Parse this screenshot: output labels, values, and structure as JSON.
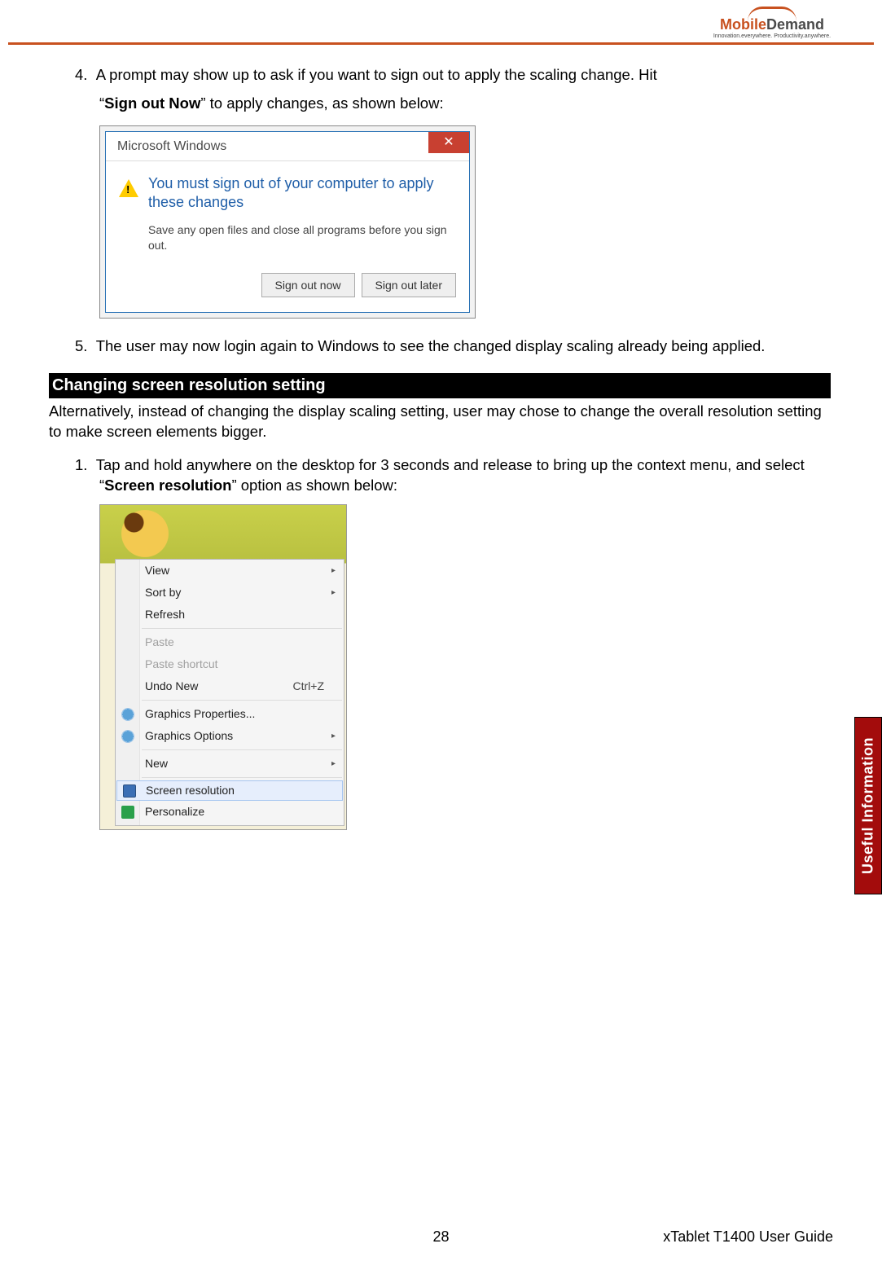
{
  "logo": {
    "brand_part1": "Mobile",
    "brand_part2": "Demand",
    "tagline": "Innovation.everywhere. Productivity.anywhere."
  },
  "step4": {
    "num": "4.",
    "text_a": "A prompt may show up to ask if you want to sign out to apply the scaling change. Hit",
    "text_b_prefix": "“",
    "text_b_bold": "Sign out Now",
    "text_b_suffix": "” to apply changes, as shown below:"
  },
  "dialog": {
    "title": "Microsoft Windows",
    "main": "You must sign out of your computer to apply these changes",
    "sub": "Save any open files and close all programs before you sign out.",
    "btn1": "Sign out now",
    "btn2": "Sign out later"
  },
  "step5": {
    "num": "5.",
    "text": "The user may now login again to Windows to see the changed display scaling already being applied."
  },
  "section_heading": "Changing screen resolution setting",
  "section_intro": "Alternatively, instead of changing the display scaling setting, user may chose to change the overall resolution setting to make screen elements bigger.",
  "step1": {
    "num": "1.",
    "text_a": "Tap and hold anywhere on the desktop for 3 seconds and release to bring up the context menu, and select “",
    "text_bold": "Screen resolution",
    "text_b": "” option as shown below:"
  },
  "context_menu": {
    "view": "View",
    "sort_by": "Sort by",
    "refresh": "Refresh",
    "paste": "Paste",
    "paste_shortcut": "Paste shortcut",
    "undo_new": "Undo New",
    "undo_shortcut": "Ctrl+Z",
    "graphics_properties": "Graphics Properties...",
    "graphics_options": "Graphics Options",
    "new": "New",
    "screen_resolution": "Screen resolution",
    "personalize": "Personalize"
  },
  "side_tab": "Useful Information",
  "footer": {
    "page": "28",
    "doc": "xTablet T1400 User Guide"
  }
}
